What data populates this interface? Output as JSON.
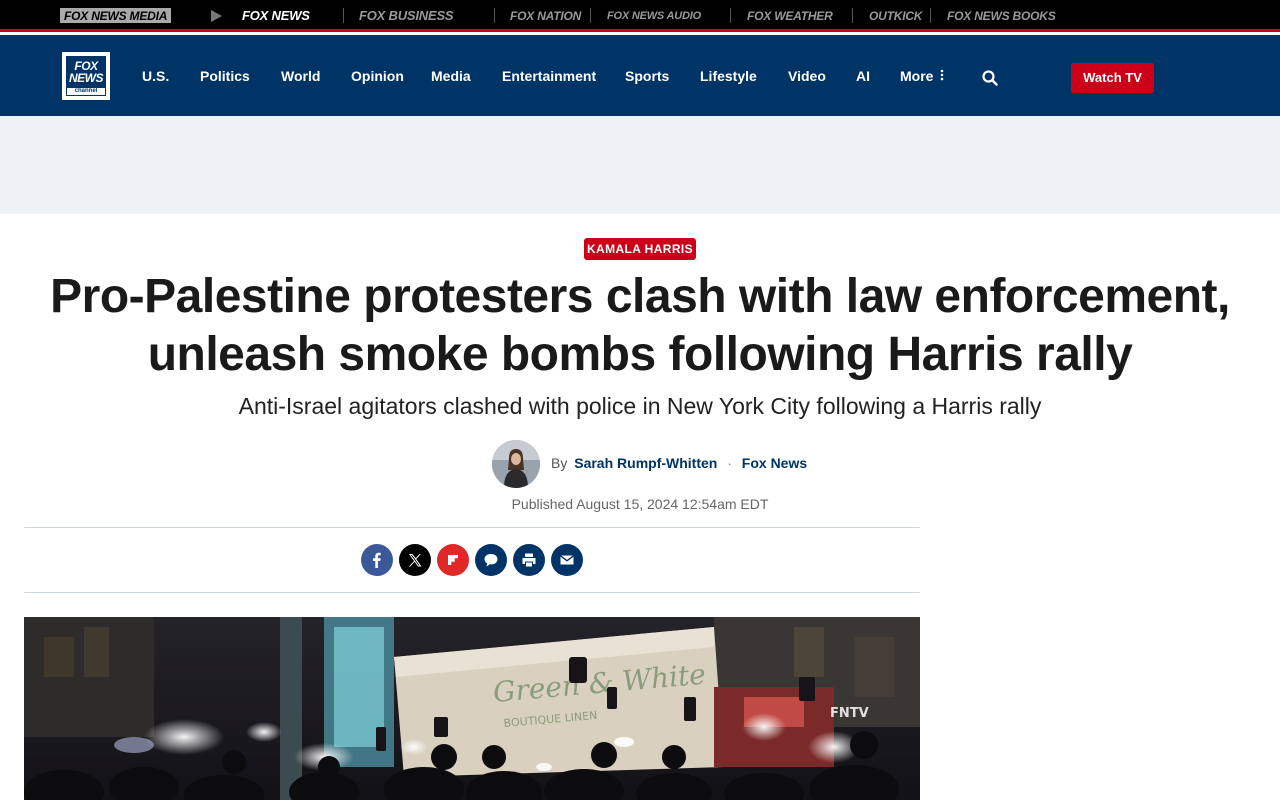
{
  "network_bar": {
    "brands": [
      "FOX NEWS media",
      "FOX NEWS",
      "FOX BUSINESS",
      "FOX NATION",
      "FOX NEWS audio",
      "FOX WEATHER",
      "OUTKICK",
      "FOX NEWS books"
    ]
  },
  "header": {
    "logo": {
      "line1": "FOX",
      "line2": "NEWS",
      "line3": "channel"
    },
    "nav": [
      "U.S.",
      "Politics",
      "World",
      "Opinion",
      "Media",
      "Entertainment",
      "Sports",
      "Lifestyle",
      "Video",
      "AI",
      "More"
    ],
    "watch_label": "Watch TV"
  },
  "article": {
    "eyebrow": "KAMALA HARRIS",
    "headline": "Pro-Palestine protesters clash with law enforcement, unleash smoke bombs following Harris rally",
    "subhead": "Anti-Israel agitators clashed with police in New York City following a Harris rally",
    "byline_prefix": "By",
    "author": "Sarah Rumpf-Whitten",
    "byline_separator": "·",
    "outlet": "Fox News",
    "published": "Published August 15, 2024 12:54am EDT",
    "hero_watermark": "FNTV"
  },
  "share": {
    "buttons": [
      {
        "name": "facebook",
        "color": "#3b5998",
        "icon": "facebook-icon"
      },
      {
        "name": "x-twitter",
        "color": "#000000",
        "icon": "x-icon"
      },
      {
        "name": "flipboard",
        "color": "#e12828",
        "icon": "flipboard-icon"
      },
      {
        "name": "comments",
        "color": "#003366",
        "icon": "comment-icon"
      },
      {
        "name": "print",
        "color": "#003366",
        "icon": "print-icon"
      },
      {
        "name": "email",
        "color": "#003366",
        "icon": "email-icon"
      }
    ]
  },
  "colors": {
    "brand_blue": "#003366",
    "brand_red": "#cc0018",
    "ad_bg": "#eef2f5"
  }
}
